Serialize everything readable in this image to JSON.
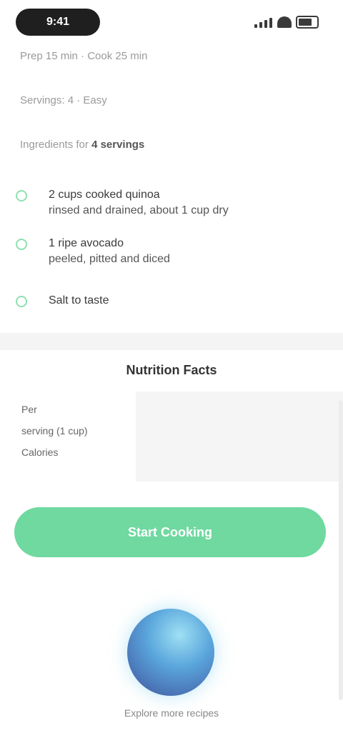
{
  "status": {
    "time": "9:41",
    "icons": [
      "signal-icon",
      "wifi-icon",
      "battery-icon"
    ]
  },
  "recipe": {
    "meta_line_1": "Prep 15 min · Cook 25 min",
    "meta_line_2": "Servings: 4 · Easy",
    "meta_line_3_prefix": "Ingredients for",
    "meta_line_3_value": "4 servings"
  },
  "ingredients": [
    {
      "title": "2 cups cooked quinoa",
      "sub": "rinsed and drained, about 1 cup dry"
    },
    {
      "title": "1 ripe avocado",
      "sub": "peeled, pitted and diced"
    },
    {
      "title": "Salt to taste",
      "sub": ""
    }
  ],
  "nutrition": {
    "title": "Nutrition Facts",
    "labels": [
      "Per",
      "serving (1 cup)",
      "Calories"
    ]
  },
  "cta": {
    "label": "Start Cooking"
  },
  "footer": {
    "caption": "Explore more recipes"
  },
  "colors": {
    "accent": "#6fd9a0",
    "check_border": "#8fe0b0"
  }
}
